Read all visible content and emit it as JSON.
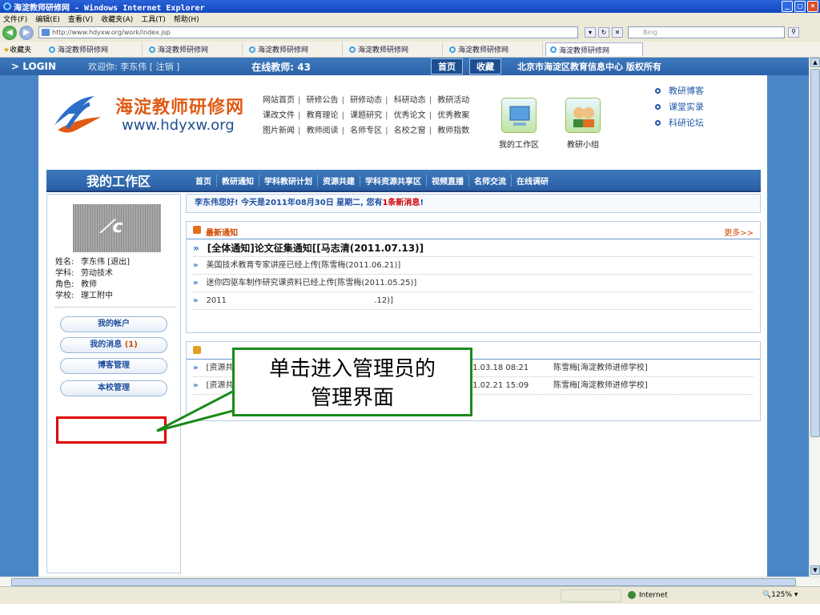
{
  "window": {
    "title": "海淀教师研修网 - Windows Internet Explorer",
    "min": "_",
    "max": "□",
    "close": "×"
  },
  "menu": [
    "文件(F)",
    "编辑(E)",
    "查看(V)",
    "收藏夹(A)",
    "工具(T)",
    "帮助(H)"
  ],
  "address": {
    "url": "http://www.hdyxw.org/work/index.jsp",
    "search_placeholder": "Bing"
  },
  "favorites_label": "收藏夹",
  "tabs": [
    {
      "label": "海淀教师研修网",
      "active": false
    },
    {
      "label": "海淀教师研修网",
      "active": false
    },
    {
      "label": "海淀教师研修网",
      "active": false
    },
    {
      "label": "海淀教师研修网",
      "active": false
    },
    {
      "label": "海淀教师研修网",
      "active": false
    },
    {
      "label": "海淀教师研修网",
      "active": true
    }
  ],
  "topstrip": {
    "login": "> LOGIN",
    "welcome": "欢迎你: 李东伟 [ 注销 ]",
    "online": "在线教师: 43",
    "home": "首页",
    "bookmark": "收藏",
    "copyright": "北京市海淀区教育信息中心 版权所有"
  },
  "header": {
    "title": "海淀教师研修网",
    "url": "www.hdyxw.org",
    "nav_rows": [
      [
        "网站首页",
        "研修公告",
        "研修动态",
        "科研动态",
        "教研活动"
      ],
      [
        "课改文件",
        "教育理论",
        "课题研究",
        "优秀论文",
        "优秀教案"
      ],
      [
        "图片新闻",
        "教师阅读",
        "名师专区",
        "名校之窗",
        "教师指数"
      ]
    ],
    "quick_workspace": "我的工作区",
    "quick_group": "教研小组",
    "right_links": [
      "教研博客",
      "课堂实录",
      "科研论坛"
    ]
  },
  "navbar": {
    "title": "我的工作区",
    "items": [
      "首页",
      "教研通知",
      "学科教研计划",
      "资源共建",
      "学科资源共享区",
      "视频直播",
      "名师交流",
      "在线调研"
    ]
  },
  "profile": {
    "name_label": "姓名:",
    "name": "李东伟 [退出]",
    "subject_label": "学科:",
    "subject": "劳动技术",
    "role_label": "角色:",
    "role": "教师",
    "school_label": "学校:",
    "school": "理工附中"
  },
  "side_buttons": {
    "account": "我的帐户",
    "messages": "我的消息",
    "messages_count": "(1)",
    "blog": "博客管理",
    "school_admin": "本校管理"
  },
  "greeting": {
    "prefix": "李东伟您好! 今天是2011年08月30日 星期二, 您有",
    "count": "1条新消息",
    "suffix": "!"
  },
  "notices": {
    "title": "最新通知",
    "more": "更多>>",
    "items": [
      "[全体通知]论文征集通知[[马志清(2011.07.13)]",
      "美国技术教育专家讲座已经上传[陈雪梅(2011.06.21)]",
      "迷你四驱车制作研究课资料已经上传[陈雪梅(2011.05.25)]",
      "2011                                                          .12)]"
    ]
  },
  "resources": {
    "items": [
      {
        "title": "[资源共建]",
        "date": "2011.03.18 08:21",
        "who": "陈雪梅[海淀教师进修学校]"
      },
      {
        "title": "[资源共建]VideoCaptureV2...",
        "date": "2011.02.21 15:09",
        "who": "陈雪梅[海淀教师进修学校]"
      }
    ]
  },
  "callout": {
    "line1": "单击进入管理员的",
    "line2": "管理界面"
  },
  "status": {
    "zone": "Internet",
    "zoom": "125%"
  },
  "colors": {
    "accent_blue": "#3c79be",
    "orange": "#e05a14",
    "highlight_red": "#e00000",
    "callout_green": "#1a8a1a"
  }
}
